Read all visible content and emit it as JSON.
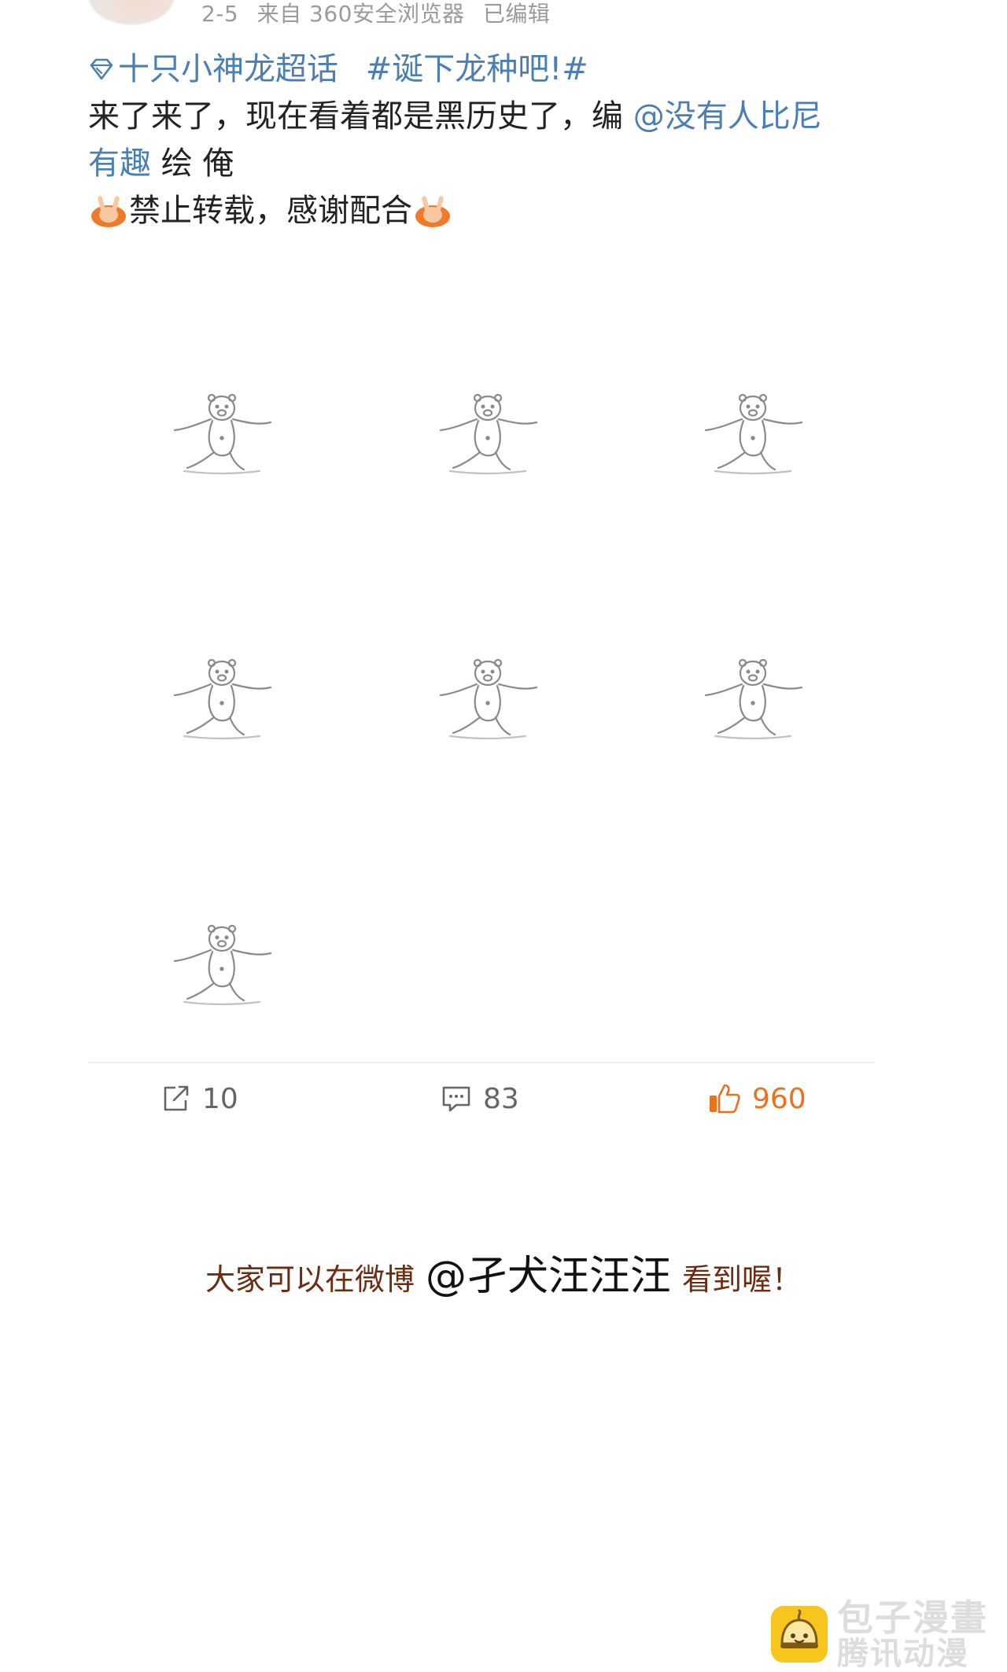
{
  "header": {
    "date": "2-5",
    "source": "来自 360安全浏览器",
    "edited": "已编辑"
  },
  "post": {
    "supertopic": "十只小神龙超话",
    "hashtag": "#诞下龙种吧!#",
    "line2_text": "来了来了，现在看着都是黑历史了，编",
    "mention1_part1": "@没有人比尼",
    "mention1_part2": "有趣",
    "line3_rest": " 绘 俺",
    "line4_text": "禁止转载，感谢配合"
  },
  "images": {
    "count": 7,
    "icon": "stretching-bear-placeholder-icon"
  },
  "actions": {
    "repost_count": "10",
    "comment_count": "83",
    "like_count": "960",
    "like_color": "#e8731f",
    "repost_icon": "share-icon",
    "comment_icon": "comment-icon",
    "like_icon": "thumbs-up-icon"
  },
  "promo": {
    "prefix": "大家可以在微博",
    "handle": "@孑犬汪汪汪",
    "suffix": "看到喔！"
  },
  "watermark": {
    "text_top": "包子漫畫",
    "text_bottom": "腾讯动漫"
  },
  "colors": {
    "link": "#4b7fb3",
    "meta_gray": "#9a9a9a",
    "logo_yellow": "#f7c51e"
  }
}
